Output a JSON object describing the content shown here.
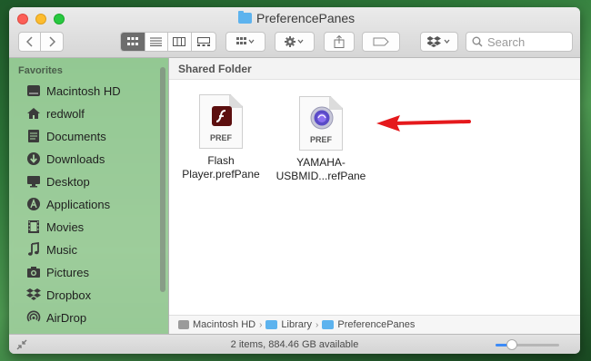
{
  "window": {
    "title": "PreferencePanes"
  },
  "toolbar": {
    "back_icon": "chevron-left-icon",
    "forward_icon": "chevron-right-icon",
    "view_modes": [
      "icon-view-icon",
      "list-view-icon",
      "column-view-icon",
      "gallery-view-icon"
    ],
    "active_view": "icon-view-icon",
    "group_icon": "group-by-icon",
    "action_icon": "gear-icon",
    "share_icon": "share-icon",
    "tag_icon": "tag-icon",
    "dropbox_icon": "dropbox-icon",
    "search_placeholder": "Search"
  },
  "sidebar": {
    "heading": "Favorites",
    "items": [
      {
        "label": "Macintosh HD",
        "icon": "hard-drive-icon"
      },
      {
        "label": "redwolf",
        "icon": "home-icon"
      },
      {
        "label": "Documents",
        "icon": "documents-icon"
      },
      {
        "label": "Downloads",
        "icon": "downloads-icon"
      },
      {
        "label": "Desktop",
        "icon": "desktop-icon"
      },
      {
        "label": "Applications",
        "icon": "applications-icon"
      },
      {
        "label": "Movies",
        "icon": "movies-icon"
      },
      {
        "label": "Music",
        "icon": "music-icon"
      },
      {
        "label": "Pictures",
        "icon": "pictures-icon"
      },
      {
        "label": "Dropbox",
        "icon": "dropbox-icon"
      },
      {
        "label": "AirDrop",
        "icon": "airdrop-icon"
      }
    ]
  },
  "content": {
    "section_title": "Shared Folder",
    "files": [
      {
        "name_line1": "Flash",
        "name_line2": "Player.prefPane",
        "badge": "PREF",
        "icon": "flash-icon"
      },
      {
        "name_line1": "YAMAHA-",
        "name_line2": "USBMID...refPane",
        "badge": "PREF",
        "icon": "yamaha-pref-icon"
      }
    ]
  },
  "pathbar": {
    "items": [
      "Macintosh HD",
      "Library",
      "PreferencePanes"
    ]
  },
  "status": {
    "text": "2 items, 884.46 GB available",
    "zoom": 0.25
  },
  "colors": {
    "arrow": "#e5191c",
    "accent": "#3d8bf7",
    "folder": "#5db3ee"
  }
}
